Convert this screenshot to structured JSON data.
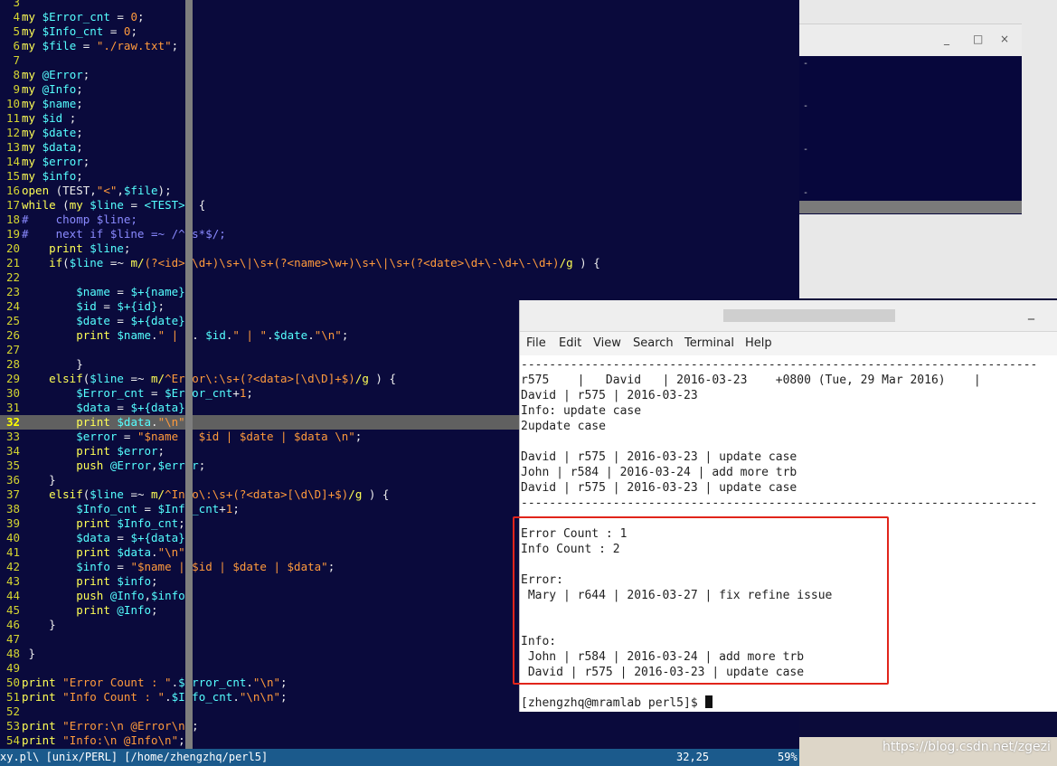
{
  "editor": {
    "lines": [
      {
        "n": "3",
        "html": ""
      },
      {
        "n": "4",
        "html": "<span class='kw'>my</span> <span class='var'>$Error_cnt</span> = <span class='str'>0</span>;"
      },
      {
        "n": "5",
        "html": "<span class='kw'>my</span> <span class='var'>$Info_cnt</span> = <span class='str'>0</span>;"
      },
      {
        "n": "6",
        "html": "<span class='kw'>my</span> <span class='var'>$file</span> = <span class='str'>\"./raw.txt\"</span>;"
      },
      {
        "n": "7",
        "html": ""
      },
      {
        "n": "8",
        "html": "<span class='kw'>my</span> <span class='var'>@Error</span>;"
      },
      {
        "n": "9",
        "html": "<span class='kw'>my</span> <span class='var'>@Info</span>;"
      },
      {
        "n": "10",
        "html": "<span class='kw'>my</span> <span class='var'>$name</span>;"
      },
      {
        "n": "11",
        "html": "<span class='kw'>my</span> <span class='var'>$id</span> ;"
      },
      {
        "n": "12",
        "html": "<span class='kw'>my</span> <span class='var'>$date</span>;"
      },
      {
        "n": "13",
        "html": "<span class='kw'>my</span> <span class='var'>$data</span>;"
      },
      {
        "n": "14",
        "html": "<span class='kw'>my</span> <span class='var'>$error</span>;"
      },
      {
        "n": "15",
        "html": "<span class='kw'>my</span> <span class='var'>$info</span>;"
      },
      {
        "n": "16",
        "html": "<span class='kw'>open</span> (TEST,<span class='str'>\"&lt;\"</span>,<span class='var'>$file</span>);"
      },
      {
        "n": "17",
        "html": "<span class='kw'>while</span> (<span class='kw'>my</span> <span class='var'>$line</span> = <span class='var'>&lt;TEST&gt;</span>) {"
      },
      {
        "n": "18",
        "html": "<span class='cmt'>#    chomp $line;</span>"
      },
      {
        "n": "19",
        "html": "<span class='cmt'>#    next if $line =~ /^\\s*$/;</span>"
      },
      {
        "n": "20",
        "html": "    <span class='kw'>print</span> <span class='var'>$line</span>;"
      },
      {
        "n": "21",
        "html": "    <span class='kw'>if</span>(<span class='var'>$line</span> =~ <span class='kw'>m/</span><span class='str'>(?&lt;id&gt;r\\d+)\\s+\\|\\s+(?&lt;name&gt;\\w+)\\s+\\|\\s+(?&lt;date&gt;\\d+\\-\\d+\\-\\d+)</span><span class='kw'>/g</span> ) {"
      },
      {
        "n": "22",
        "html": ""
      },
      {
        "n": "23",
        "html": "        <span class='var'>$name</span> = <span class='var'>$+{name}</span>;"
      },
      {
        "n": "24",
        "html": "        <span class='var'>$id</span> = <span class='var'>$+{id}</span>;"
      },
      {
        "n": "25",
        "html": "        <span class='var'>$date</span> = <span class='var'>$+{date}</span>;"
      },
      {
        "n": "26",
        "html": "        <span class='kw'>print</span> <span class='var'>$name</span>.<span class='str'>\" | \"</span>. <span class='var'>$id</span>.<span class='str'>\" | \"</span>.<span class='var'>$date</span>.<span class='str'>\"\\n\"</span>;"
      },
      {
        "n": "27",
        "html": ""
      },
      {
        "n": "28",
        "html": "        }"
      },
      {
        "n": "29",
        "html": "    <span class='kw'>elsif</span>(<span class='var'>$line</span> =~ <span class='kw'>m/</span><span class='str'>^Error\\:\\s+(?&lt;data&gt;[\\d\\D]+$)</span><span class='kw'>/g</span> ) {"
      },
      {
        "n": "30",
        "html": "        <span class='var'>$Error_cnt</span> = <span class='var'>$Error_cnt</span>+<span class='str'>1</span>;"
      },
      {
        "n": "31",
        "html": "        <span class='var'>$data</span> = <span class='var'>$+{data}</span>;"
      },
      {
        "n": "32",
        "cur": true,
        "html": "        <span class='kw'>print</span> <span class='var'>$data</span>.<span class='str'>\"\\n\"</span>;"
      },
      {
        "n": "33",
        "html": "        <span class='var'>$error</span> = <span class='str'>\"$name | $id | $date | $data \\n\"</span>;"
      },
      {
        "n": "34",
        "html": "        <span class='kw'>print</span> <span class='var'>$error</span>;"
      },
      {
        "n": "35",
        "html": "        <span class='kw'>push</span> <span class='var'>@Error</span>,<span class='var'>$error</span>;"
      },
      {
        "n": "36",
        "html": "    }"
      },
      {
        "n": "37",
        "html": "    <span class='kw'>elsif</span>(<span class='var'>$line</span> =~ <span class='kw'>m/</span><span class='str'>^Info\\:\\s+(?&lt;data&gt;[\\d\\D]+$)</span><span class='kw'>/g</span> ) {"
      },
      {
        "n": "38",
        "html": "        <span class='var'>$Info_cnt</span> = <span class='var'>$Info_cnt</span>+<span class='str'>1</span>;"
      },
      {
        "n": "39",
        "html": "        <span class='kw'>print</span> <span class='var'>$Info_cnt</span>;"
      },
      {
        "n": "40",
        "html": "        <span class='var'>$data</span> = <span class='var'>$+{data}</span>;"
      },
      {
        "n": "41",
        "html": "        <span class='kw'>print</span> <span class='var'>$data</span>.<span class='str'>\"\\n\"</span>;"
      },
      {
        "n": "42",
        "html": "        <span class='var'>$info</span> = <span class='str'>\"$name | $id | $date | $data\"</span>;"
      },
      {
        "n": "43",
        "html": "        <span class='kw'>print</span> <span class='var'>$info</span>;"
      },
      {
        "n": "44",
        "html": "        <span class='kw'>push</span> <span class='var'>@Info</span>,<span class='var'>$info</span>;"
      },
      {
        "n": "45",
        "html": "        <span class='kw'>print</span> <span class='var'>@Info</span>;"
      },
      {
        "n": "46",
        "html": "    }"
      },
      {
        "n": "47",
        "html": ""
      },
      {
        "n": "48",
        "html": " }"
      },
      {
        "n": "49",
        "html": ""
      },
      {
        "n": "50",
        "html": "<span class='kw'>print</span> <span class='str'>\"Error Count : \"</span>.<span class='var'>$Error_cnt</span>.<span class='str'>\"\\n\"</span>;"
      },
      {
        "n": "51",
        "html": "<span class='kw'>print</span> <span class='str'>\"Info Count : \"</span>.<span class='var'>$Info_cnt</span>.<span class='str'>\"\\n\\n\"</span>;"
      },
      {
        "n": "52",
        "html": ""
      },
      {
        "n": "53",
        "html": "<span class='kw'>print</span> <span class='str'>\"Error:\\n @Error\\n\"</span>;"
      },
      {
        "n": "54",
        "html": "<span class='kw'>print</span> <span class='str'>\"Info:\\n @Info\\n\"</span>;"
      }
    ],
    "status_left": "xy.pl\\ [unix/PERL] [/home/zhengzhq/perl5]",
    "status_pos": "32,25",
    "status_pct": "59%"
  },
  "bg_window": {
    "minimize": "_",
    "maximize": "□",
    "close": "×"
  },
  "terminal": {
    "minimize": "_",
    "menu": [
      "File",
      "Edit",
      "View",
      "Search",
      "Terminal",
      "Help"
    ],
    "output": [
      "-------------------------------------------------------------------------",
      "r575    |   David   | 2016-03-23    +0800 (Tue, 29 Mar 2016)    |",
      "David | r575 | 2016-03-23",
      "Info: update case",
      "2update case",
      "",
      "David | r575 | 2016-03-23 | update case",
      "John | r584 | 2016-03-24 | add more trb",
      "David | r575 | 2016-03-23 | update case",
      "-------------------------------------------------------------------------",
      "",
      "Error Count : 1",
      "Info Count : 2",
      "",
      "Error:",
      " Mary | r644 | 2016-03-27 | fix refine issue",
      "",
      "",
      "Info:",
      " John | r584 | 2016-03-24 | add more trb",
      " David | r575 | 2016-03-23 | update case",
      ""
    ],
    "prompt": "[zhengzhq@mramlab perl5]$ "
  },
  "watermark": "https://blog.csdn.net/zgezi"
}
